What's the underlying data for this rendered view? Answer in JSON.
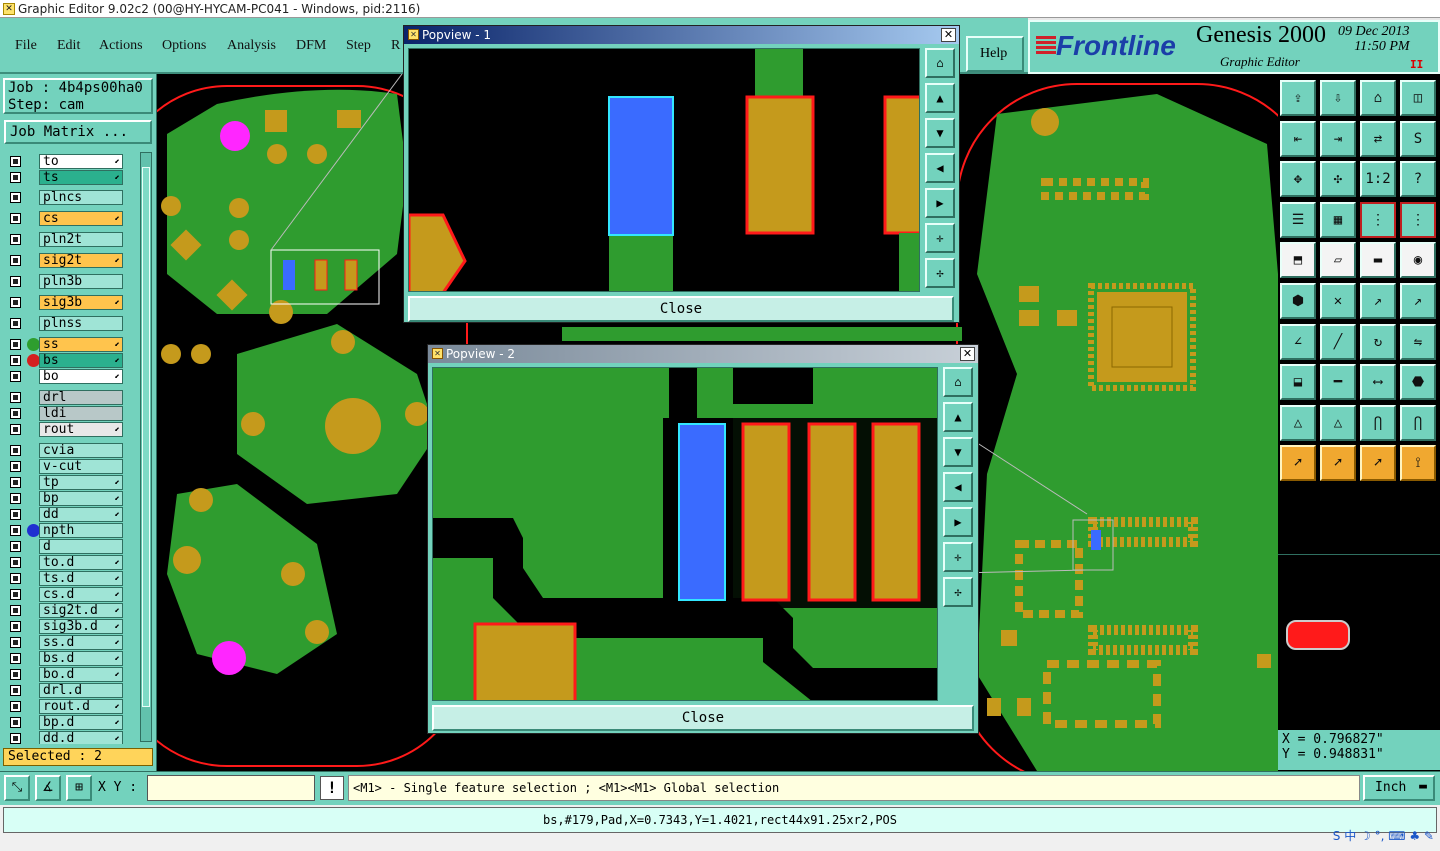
{
  "window": {
    "title": "Graphic Editor 9.02c2 (00@HY-HYCAM-PC041 - Windows, pid:2116)"
  },
  "menu": {
    "items": [
      "File",
      "Edit",
      "Actions",
      "Options",
      "Analysis",
      "DFM",
      "Step",
      "R"
    ],
    "help": "Help"
  },
  "brand": {
    "logo": "Frontline",
    "product": "Genesis 2000",
    "subtitle": "Graphic Editor",
    "date": "09 Dec 2013",
    "time": "11:50 PM",
    "pause": "II"
  },
  "job": {
    "job_line": "Job : 4b4ps00ha0",
    "step_line": "Step: cam",
    "matrix_button": "Job Matrix ..."
  },
  "layers": [
    {
      "name": "to",
      "color": "#ffffff",
      "arrow": true
    },
    {
      "name": "ts",
      "color": "#2bb08e",
      "arrow": true
    },
    {
      "name": "plncs",
      "color": "#9fe4d6",
      "arrow": false
    },
    {
      "name": "cs",
      "color": "#ffc44d",
      "arrow": true
    },
    {
      "name": "pln2t",
      "color": "#9fe4d6",
      "arrow": false
    },
    {
      "name": "sig2t",
      "color": "#ffc44d",
      "arrow": true
    },
    {
      "name": "pln3b",
      "color": "#9fe4d6",
      "arrow": false
    },
    {
      "name": "sig3b",
      "color": "#ffc44d",
      "arrow": true
    },
    {
      "name": "plnss",
      "color": "#9fe4d6",
      "arrow": false
    },
    {
      "name": "ss",
      "color": "#ffc44d",
      "arrow": true,
      "dot": "#2e9e2e"
    },
    {
      "name": "bs",
      "color": "#2bb08e",
      "arrow": true,
      "dot": "#d42020"
    },
    {
      "name": "bo",
      "color": "#ffffff",
      "arrow": true
    },
    {
      "name": "drl",
      "color": "#b8c8c8",
      "arrow": false
    },
    {
      "name": "ldi",
      "color": "#b8c8c8",
      "arrow": false
    },
    {
      "name": "rout",
      "color": "#e8e8e8",
      "arrow": true
    },
    {
      "name": "cvia",
      "color": "#9fe4d6",
      "arrow": false
    },
    {
      "name": "v-cut",
      "color": "#9fe4d6",
      "arrow": false
    },
    {
      "name": "tp",
      "color": "#9fe4d6",
      "arrow": true
    },
    {
      "name": "bp",
      "color": "#9fe4d6",
      "arrow": true
    },
    {
      "name": "dd",
      "color": "#9fe4d6",
      "arrow": true
    },
    {
      "name": "npth",
      "color": "#9fe4d6",
      "arrow": false,
      "dot": "#2030d0"
    },
    {
      "name": "d",
      "color": "#9fe4d6",
      "arrow": false
    },
    {
      "name": "to.d",
      "color": "#9fe4d6",
      "arrow": true
    },
    {
      "name": "ts.d",
      "color": "#9fe4d6",
      "arrow": true
    },
    {
      "name": "cs.d",
      "color": "#9fe4d6",
      "arrow": true
    },
    {
      "name": "sig2t.d",
      "color": "#9fe4d6",
      "arrow": true
    },
    {
      "name": "sig3b.d",
      "color": "#9fe4d6",
      "arrow": true
    },
    {
      "name": "ss.d",
      "color": "#9fe4d6",
      "arrow": true
    },
    {
      "name": "bs.d",
      "color": "#9fe4d6",
      "arrow": true
    },
    {
      "name": "bo.d",
      "color": "#9fe4d6",
      "arrow": true
    },
    {
      "name": "drl.d",
      "color": "#9fe4d6",
      "arrow": false
    },
    {
      "name": "rout.d",
      "color": "#9fe4d6",
      "arrow": true
    },
    {
      "name": "bp.d",
      "color": "#9fe4d6",
      "arrow": true
    },
    {
      "name": "dd.d",
      "color": "#9fe4d6",
      "arrow": true
    }
  ],
  "selected": "Selected : 2",
  "popup1": {
    "title": "Popview - 1",
    "close": "Close"
  },
  "popup2": {
    "title": "Popview - 2",
    "close": "Close"
  },
  "toolbar_labels": {
    "one_to_two": "1:2",
    "help_q": "?"
  },
  "coords": {
    "x": "X = 0.796827\"",
    "y": "Y = 0.948831\""
  },
  "status": {
    "xy_label": "X Y :",
    "xy_value": "",
    "exclaim": "!",
    "message": "<M1> - Single feature selection ; <M1><M1> Global selection",
    "unit": "Inch"
  },
  "info": "bs,#179,Pad,X=0.7343,Y=1.4021,rect44x91.25xr2,POS",
  "tray": "S 中 ☽ °, ⌨ ♣ ✎",
  "colors": {
    "board": "#2f9c2f",
    "copper": "#c59a1c",
    "selected": "#3a6bff",
    "outline": "#ff1a1a",
    "via": "#ff26ff"
  }
}
